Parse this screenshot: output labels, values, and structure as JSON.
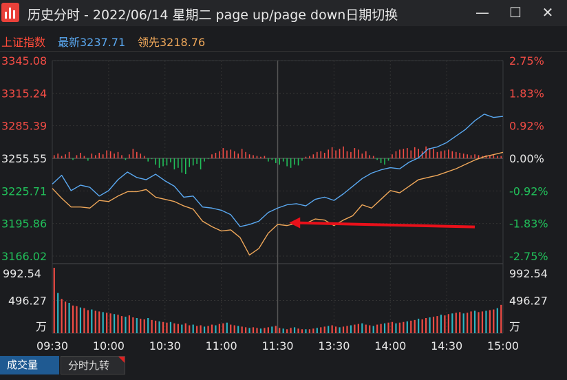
{
  "window": {
    "title": "历史分时 - 2022/06/14 星期二 page up/page down日期切换",
    "minimize_icon": "minimize-icon",
    "maximize_icon": "maximize-icon",
    "close_icon": "close-icon"
  },
  "info": {
    "index_name": "上证指数",
    "latest_label": "最新3237.71",
    "leader_label": "领先3218.76"
  },
  "colors": {
    "up": "#f24c45",
    "down": "#21c05a",
    "latest_line": "#5aa9f2",
    "leader_line": "#f0a85a",
    "neutral": "#e8e8e8",
    "arrow": "#e8101a"
  },
  "chart_data": {
    "type": "line",
    "prev_close": 3255.55,
    "price_axis": {
      "ylim": [
        3166.02,
        3345.08
      ],
      "left_ticks": [
        "3345.08",
        "3315.24",
        "3285.39",
        "3255.55",
        "3225.71",
        "3195.86",
        "3166.02"
      ],
      "right_ticks": [
        "2.75%",
        "1.83%",
        "0.92%",
        "0.00%",
        "-0.92%",
        "-1.83%",
        "-2.75%"
      ]
    },
    "x_ticks": [
      "09:30",
      "10:00",
      "10:30",
      "11:00",
      "11:30",
      "13:30",
      "14:00",
      "14:30",
      "15:00"
    ],
    "series": [
      {
        "name": "最新",
        "x_minutes": [
          0,
          5,
          10,
          15,
          20,
          25,
          30,
          35,
          40,
          45,
          50,
          55,
          60,
          65,
          70,
          75,
          80,
          85,
          90,
          95,
          100,
          105,
          110,
          115,
          120,
          125,
          130,
          135,
          140,
          145,
          150,
          155,
          160,
          165,
          170,
          175,
          180,
          185,
          190,
          195,
          200,
          205,
          210,
          215,
          220,
          225,
          230,
          235,
          240
        ],
        "values": [
          3232,
          3240,
          3226,
          3231,
          3229,
          3221,
          3226,
          3236,
          3243,
          3238,
          3236,
          3241,
          3235,
          3230,
          3220,
          3221,
          3211,
          3210,
          3208,
          3204,
          3193,
          3195,
          3198,
          3206,
          3210,
          3213,
          3214,
          3212,
          3218,
          3220,
          3217,
          3223,
          3230,
          3237,
          3242,
          3245,
          3247,
          3246,
          3252,
          3256,
          3264,
          3266,
          3270,
          3276,
          3282,
          3290,
          3296,
          3293,
          3294
        ]
      },
      {
        "name": "领先",
        "x_minutes": [
          0,
          5,
          10,
          15,
          20,
          25,
          30,
          35,
          40,
          45,
          50,
          55,
          60,
          65,
          70,
          75,
          80,
          85,
          90,
          95,
          100,
          105,
          110,
          115,
          120,
          125,
          130,
          135,
          140,
          145,
          150,
          155,
          160,
          165,
          170,
          175,
          180,
          185,
          190,
          195,
          200,
          205,
          210,
          215,
          220,
          225,
          230,
          235,
          240
        ],
        "values": [
          3228,
          3219,
          3211,
          3211,
          3210,
          3217,
          3216,
          3221,
          3225,
          3225,
          3227,
          3220,
          3218,
          3216,
          3212,
          3209,
          3198,
          3193,
          3189,
          3190,
          3183,
          3167,
          3173,
          3187,
          3195,
          3194,
          3196,
          3196,
          3200,
          3199,
          3194,
          3199,
          3203,
          3213,
          3210,
          3218,
          3226,
          3224,
          3230,
          3236,
          3238,
          3240,
          3243,
          3246,
          3250,
          3254,
          3257,
          3259,
          3261
        ]
      }
    ],
    "diff_bars": {
      "note_unit": "index points",
      "values": [
        4,
        6,
        3,
        5,
        8,
        -2,
        4,
        7,
        3,
        -3,
        6,
        4,
        7,
        5,
        10,
        9,
        6,
        8,
        4,
        -2,
        5,
        12,
        8,
        6,
        3,
        -4,
        -1,
        -8,
        -12,
        -10,
        -9,
        -5,
        -14,
        -12,
        -18,
        -20,
        -11,
        -9,
        -7,
        -14,
        -4,
        -1,
        5,
        7,
        9,
        13,
        10,
        11,
        9,
        6,
        12,
        8,
        5,
        4,
        3,
        2,
        3,
        -4,
        -2,
        -6,
        -8,
        -4,
        -10,
        -12,
        -8,
        -9,
        -3,
        2,
        3,
        5,
        8,
        9,
        7,
        11,
        14,
        10,
        12,
        15,
        9,
        8,
        13,
        11,
        6,
        9,
        4,
        3,
        -2,
        -6,
        -8,
        -3,
        5,
        9,
        11,
        12,
        13,
        10,
        14,
        12,
        9,
        15,
        13,
        12,
        8,
        9,
        10,
        11,
        9,
        8,
        7,
        6,
        5,
        4,
        5,
        4,
        3,
        4,
        3,
        4,
        3,
        3
      ]
    },
    "volume": {
      "ylim": [
        0,
        992.54
      ],
      "ticks": [
        "992.54",
        "496.27"
      ],
      "unit_label": "万",
      "values": [
        992,
        610,
        520,
        480,
        460,
        420,
        410,
        390,
        380,
        350,
        360,
        340,
        330,
        320,
        310,
        300,
        290,
        280,
        260,
        250,
        270,
        240,
        230,
        220,
        210,
        230,
        200,
        190,
        180,
        170,
        160,
        170,
        150,
        140,
        130,
        150,
        120,
        130,
        110,
        120,
        100,
        110,
        130,
        120,
        140,
        150,
        160,
        130,
        120,
        110,
        100,
        90,
        80,
        90,
        80,
        70,
        80,
        90,
        100,
        110,
        80,
        70,
        60,
        80,
        90,
        70,
        60,
        60,
        60,
        70,
        80,
        90,
        100,
        110,
        120,
        100,
        90,
        100,
        110,
        120,
        130,
        140,
        150,
        130,
        120,
        110,
        130,
        140,
        150,
        160,
        170,
        150,
        160,
        170,
        180,
        190,
        200,
        220,
        210,
        230,
        240,
        250,
        260,
        280,
        270,
        290,
        300,
        310,
        320,
        300,
        310,
        330,
        340,
        320,
        330,
        340,
        350,
        360,
        380,
        430
      ]
    },
    "annotation": "arrow pointing left toward the 11:23 low"
  },
  "tabs": {
    "volume": "成交量",
    "nine_turn": "分时九转"
  }
}
